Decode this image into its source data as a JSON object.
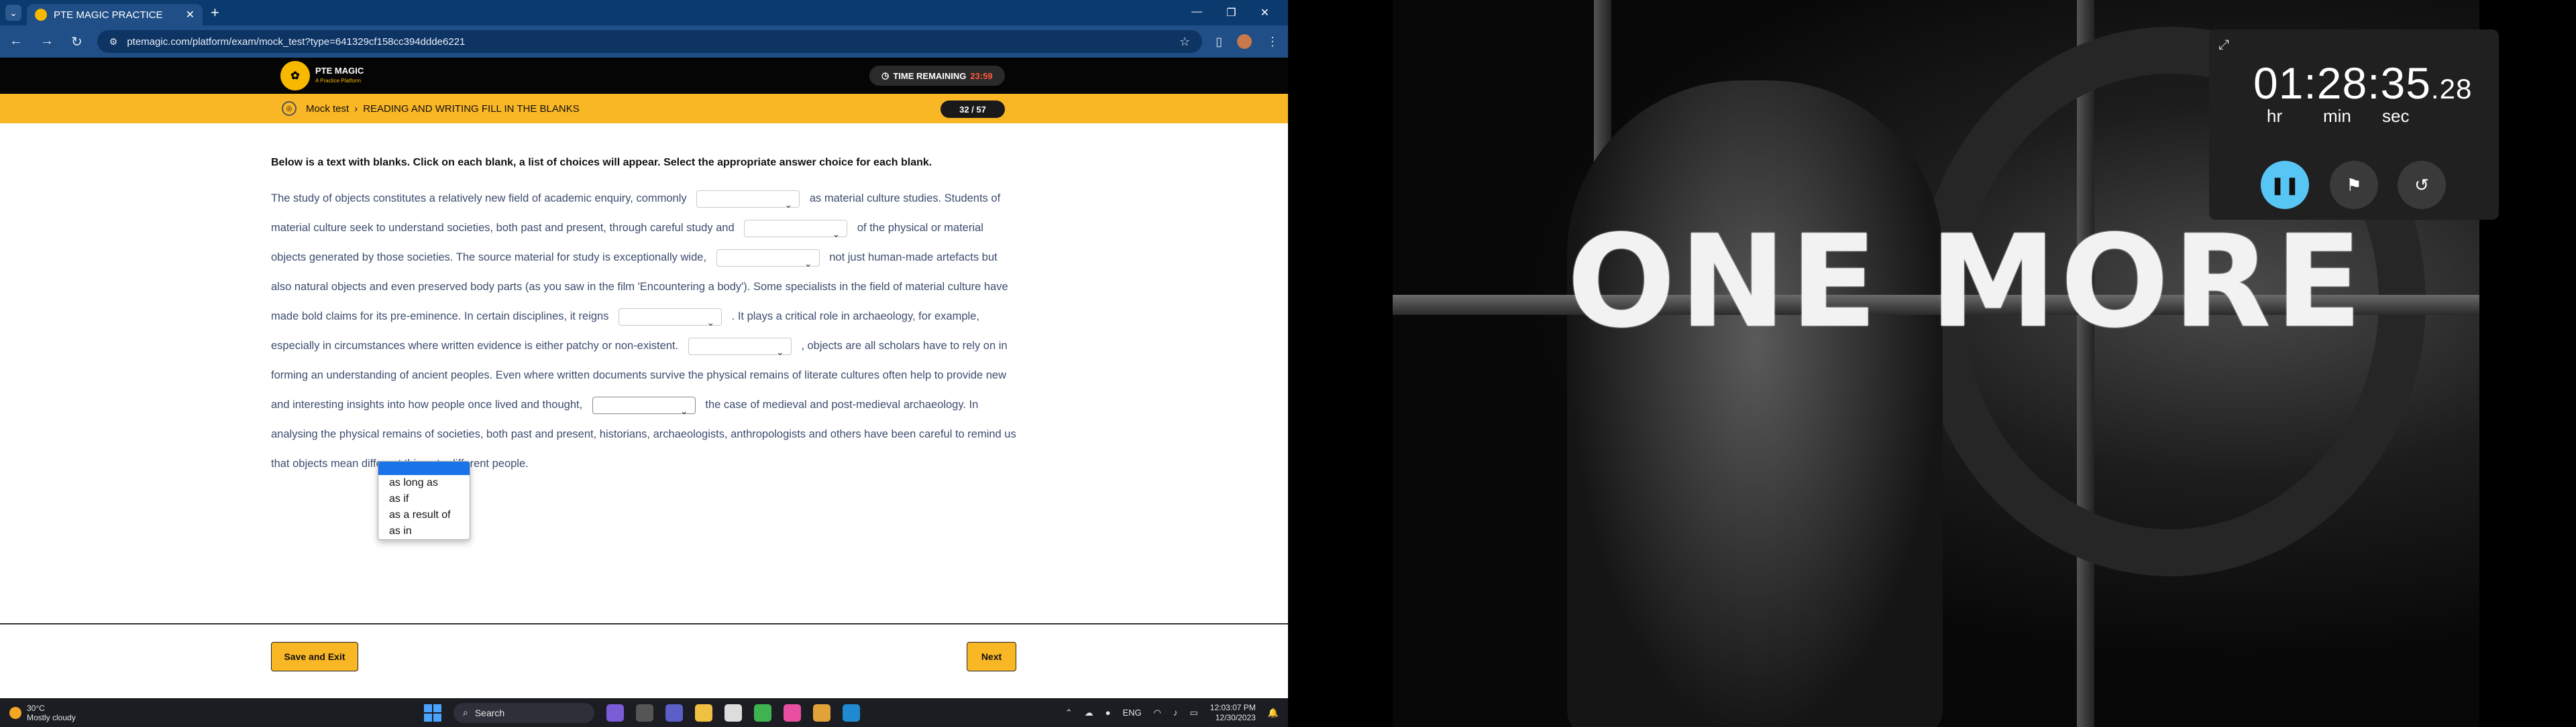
{
  "browser": {
    "tab_title": "PTE MAGIC PRACTICE",
    "url": "ptemagic.com/platform/exam/mock_test?type=641329cf158cc394ddde6221"
  },
  "site": {
    "logo_text": "PTE MAGIC",
    "logo_sub": "A Practice Platform",
    "timer_label": "TIME REMAINING",
    "timer_value": "23:59",
    "crumb_root": "Mock test",
    "crumb_section": "READING AND WRITING FILL IN THE BLANKS",
    "progress": "32 / 57"
  },
  "question": {
    "instruction": "Below is a text with blanks. Click on each blank, a list of choices will appear. Select the appropriate answer choice for each blank.",
    "seg1": "The study of objects constitutes a relatively new field of academic enquiry, commonly",
    "seg2": "as material culture studies. Students of material culture seek to understand societies, both past and present, through careful study and",
    "seg3": "of the physical or material objects generated by those societies. The source material for study is exceptionally wide,",
    "seg4": "not just human-made artefacts but also natural objects and even preserved body parts (as you saw in the film 'Encountering a body'). Some specialists in the field of material culture have made bold claims for its pre-eminence. In certain disciplines, it reigns",
    "seg5": ". It plays a critical role in archaeology, for example, especially in circumstances where written evidence is either patchy or non-existent.",
    "seg6": ", objects are all scholars have to rely on in forming an understanding of ancient peoples. Even where written documents survive the physical remains of literate cultures often help to provide new and interesting insights into how people once lived and thought,",
    "seg7": "the case of medieval and post-medieval archaeology. In analysing the physical remains of societies, both past and present, historians, archaeologists, anthropologists and others have been careful to remind us that objects mean different things to different people.",
    "dropdown_options": [
      "as long as",
      "as if",
      "as a result of",
      "as in"
    ]
  },
  "footer": {
    "save_label": "Save and Exit",
    "next_label": "Next"
  },
  "taskbar": {
    "weather_temp": "30°C",
    "weather_desc": "Mostly cloudy",
    "search_label": "Search",
    "lang": "ENG",
    "time": "12:03:07 PM",
    "date": "12/30/2023"
  },
  "photo": {
    "text": "ONE MORE"
  },
  "stopwatch": {
    "main": "01:28:35",
    "ms": ".28",
    "units": [
      "hr",
      "min",
      "sec"
    ]
  }
}
